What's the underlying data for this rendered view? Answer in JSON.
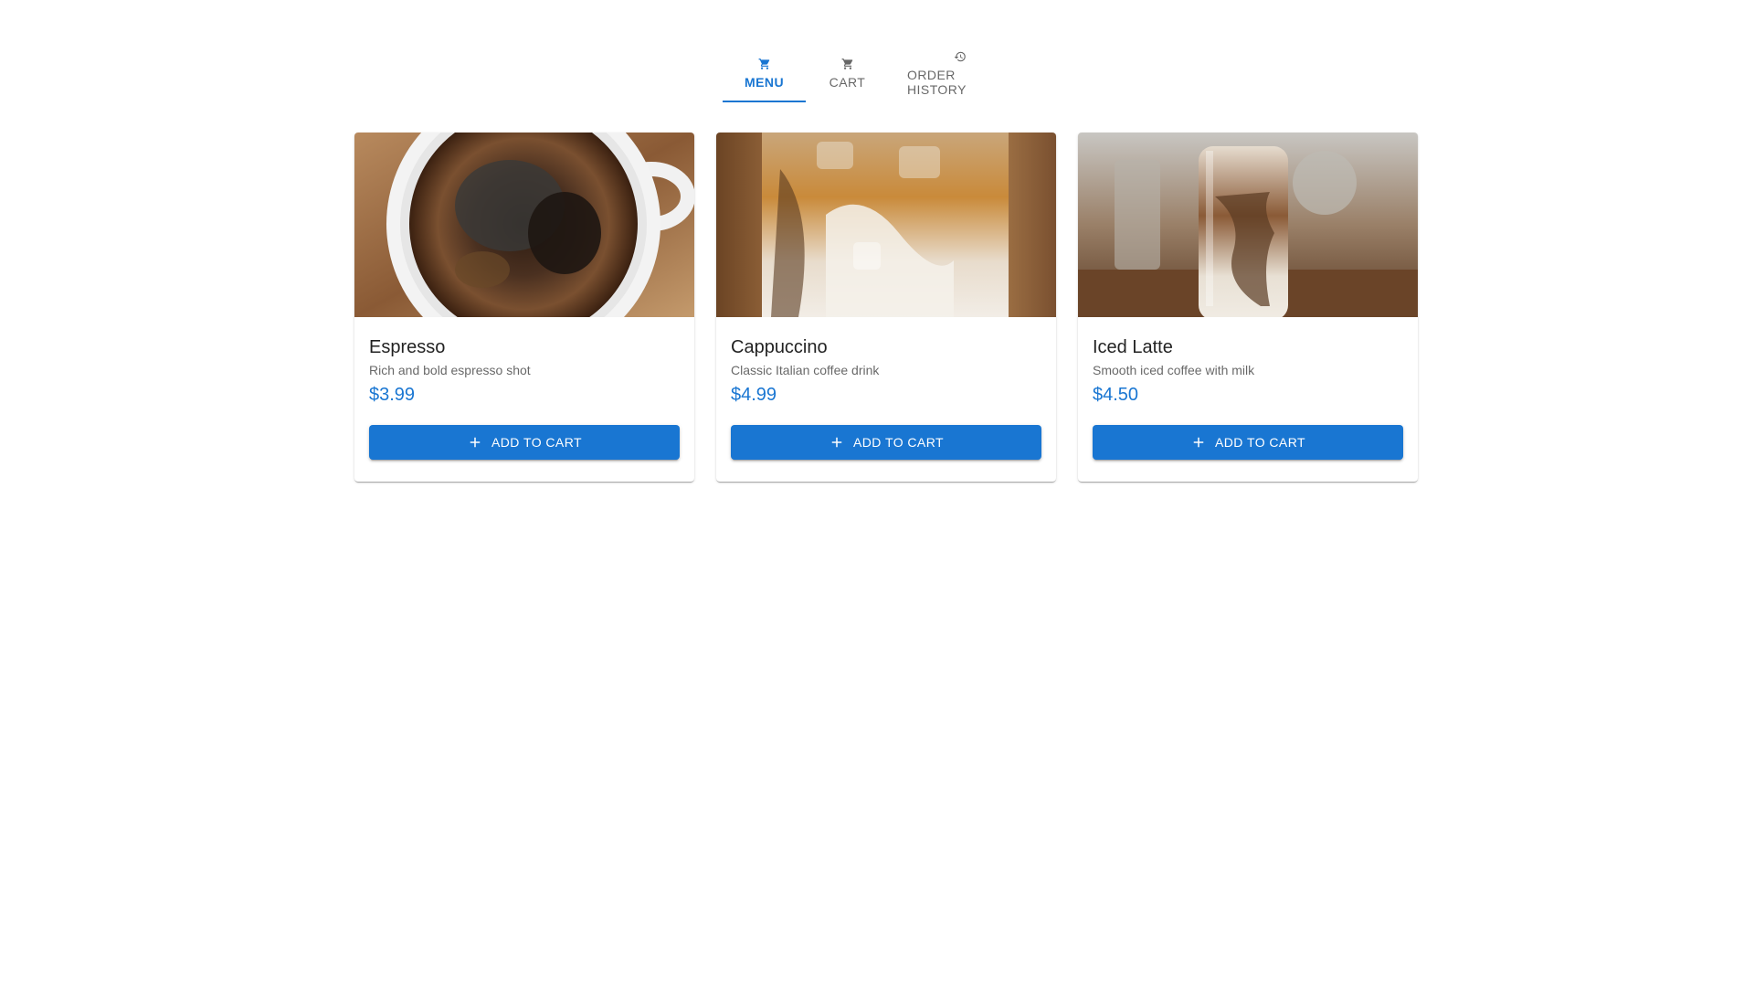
{
  "tabs": [
    {
      "label": "MENU",
      "icon": "shopping-cart-icon",
      "active": true
    },
    {
      "label": "CART",
      "icon": "shopping-cart-icon",
      "active": false
    },
    {
      "label": "ORDER HISTORY",
      "icon": "history-icon",
      "active": false
    }
  ],
  "products": [
    {
      "name": "Espresso",
      "description": "Rich and bold espresso shot",
      "price": "$3.99",
      "button_label": "ADD TO CART",
      "image": "espresso-cup-photo"
    },
    {
      "name": "Cappuccino",
      "description": "Classic Italian coffee drink",
      "price": "$4.99",
      "button_label": "ADD TO CART",
      "image": "iced-coffee-glass-photo"
    },
    {
      "name": "Iced Latte",
      "description": "Smooth iced coffee with milk",
      "price": "$4.50",
      "button_label": "ADD TO CART",
      "image": "iced-latte-jar-photo"
    }
  ],
  "colors": {
    "primary": "#1976d2",
    "text_primary": "#212121",
    "text_secondary": "#666666",
    "background": "#ffffff"
  }
}
